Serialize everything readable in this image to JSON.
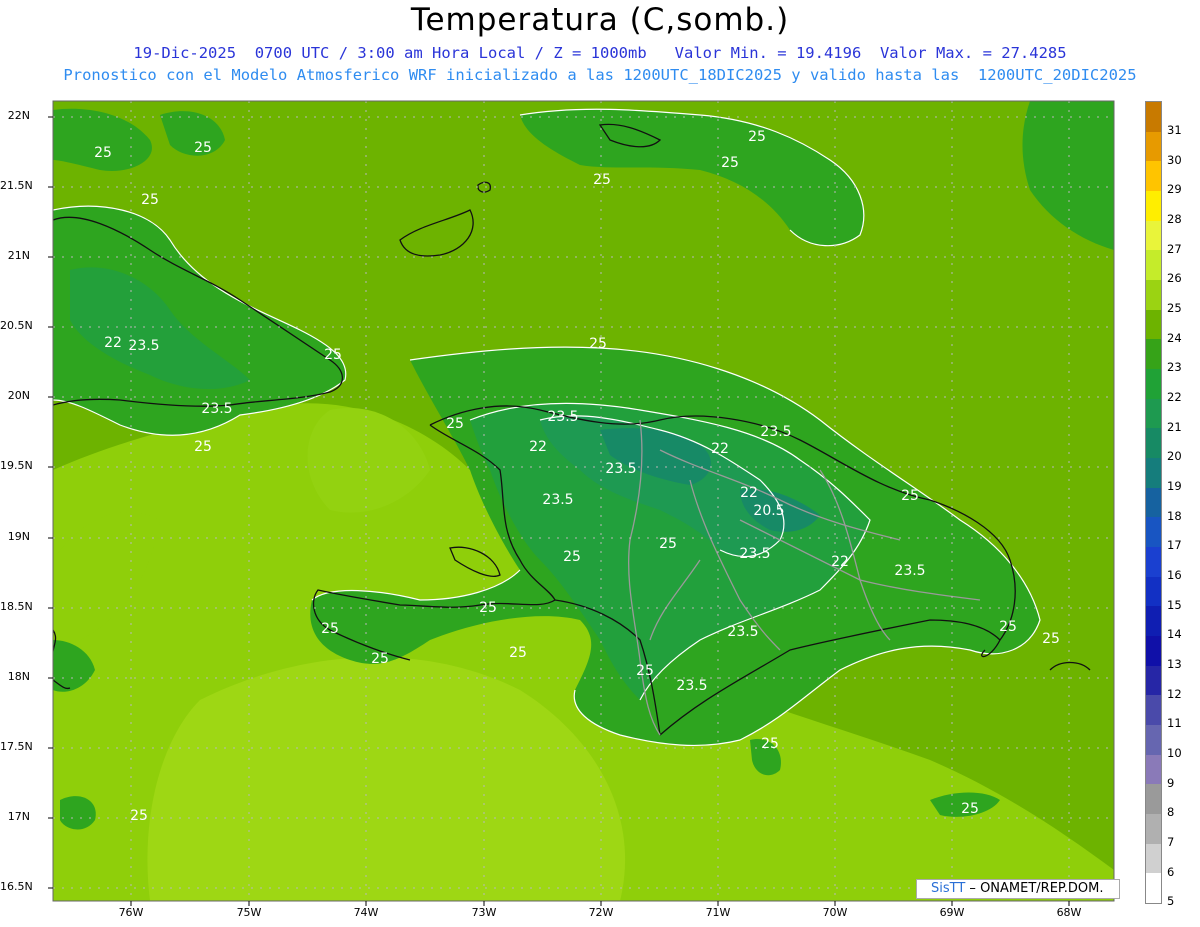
{
  "title": "Temperatura (C,somb.)",
  "subtitle_line1": "19-Dic-2025  0700 UTC / 3:00 am Hora Local / Z = 1000mb   Valor Min. = 19.4196  Valor Max. = 27.4285",
  "subtitle_line2": "Pronostico con el Modelo Atmosferico WRF inicializado a las 1200UTC_18DIC2025 y valido hasta las  1200UTC_20DIC2025",
  "lat_labels": [
    "22N",
    "21.5N",
    "21N",
    "20.5N",
    "20N",
    "19.5N",
    "19N",
    "18.5N",
    "18N",
    "17.5N",
    "17N",
    "16.5N"
  ],
  "lon_labels": [
    "76W",
    "75W",
    "74W",
    "73W",
    "72W",
    "71W",
    "70W",
    "69W",
    "68W"
  ],
  "colorbar": {
    "labels": [
      "31",
      "30",
      "29",
      "28",
      "27",
      "26",
      "25",
      "24",
      "23",
      "22",
      "21",
      "20",
      "19",
      "18",
      "17",
      "16",
      "15",
      "14",
      "13",
      "12",
      "11",
      "10",
      "9",
      "8",
      "7",
      "6",
      "5"
    ],
    "colors": [
      "#c87a00",
      "#e79a00",
      "#ffc400",
      "#ffee00",
      "#e9f43a",
      "#c5ec2a",
      "#9bd312",
      "#6db300",
      "#36a318",
      "#20a236",
      "#1e9a50",
      "#178a64",
      "#157d7c",
      "#1662a0",
      "#1855c2",
      "#1a40d0",
      "#1230c4",
      "#0f1eb2",
      "#1010a8",
      "#2626a6",
      "#4a4aaa",
      "#6666b0",
      "#8a7ab8",
      "#9a9a9a",
      "#b0b0b0",
      "#d0d0d0",
      "#ffffff"
    ]
  },
  "contour_labels": [
    "25",
    "25",
    "25",
    "25",
    "25",
    "25",
    "25",
    "25",
    "25",
    "25",
    "25",
    "25",
    "25",
    "25",
    "25",
    "25",
    "25",
    "25",
    "25",
    "25",
    "22",
    "23.5",
    "23.5",
    "23.5",
    "22",
    "23.5",
    "23.5",
    "22",
    "23.5",
    "22",
    "20.5",
    "23.5",
    "22",
    "23.5",
    "23.5",
    "23.5",
    "25",
    "25",
    "25"
  ],
  "credit": {
    "brand": "SisTT",
    "separator": " – ",
    "org": "ONAMET/REP.DOM."
  }
}
